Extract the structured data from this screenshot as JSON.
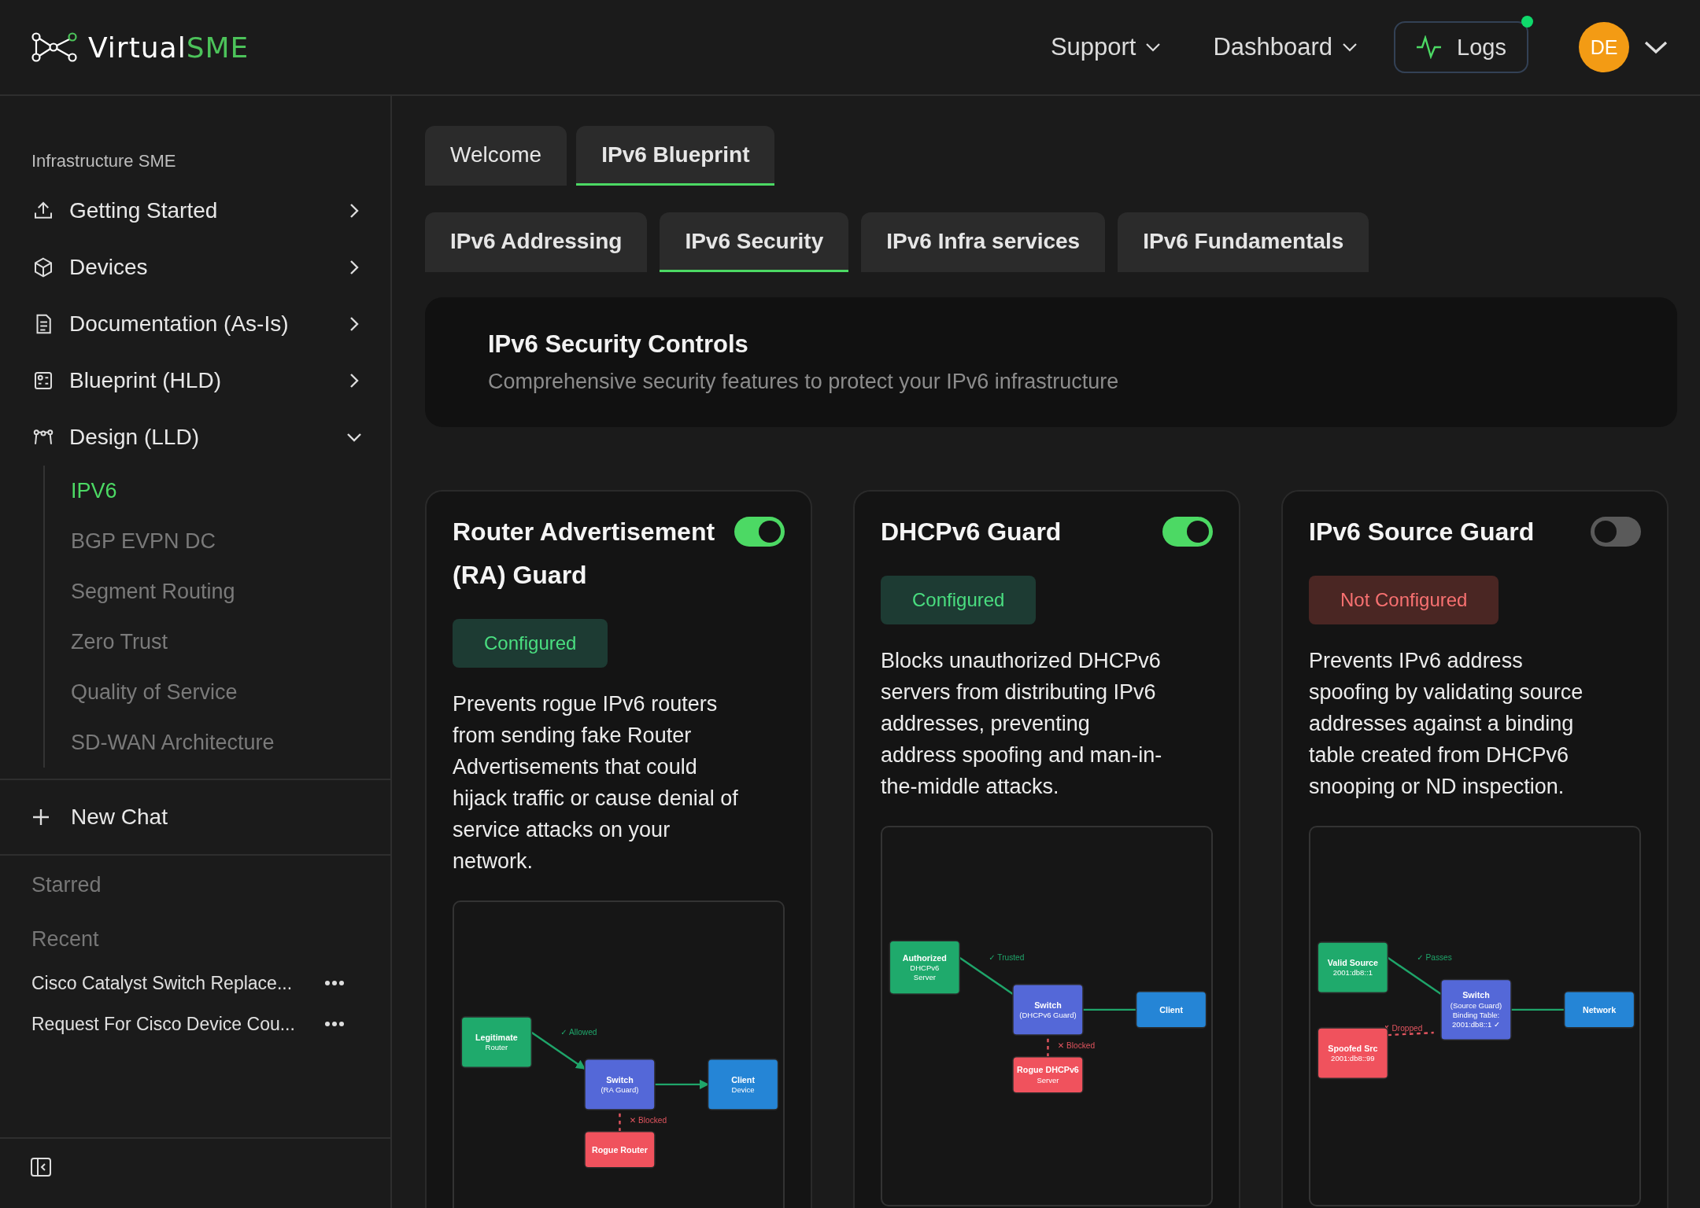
{
  "header": {
    "logo": {
      "part_1": "Virtual",
      "part_2": "SME"
    },
    "nav": [
      {
        "label": "Support"
      },
      {
        "label": "Dashboard"
      }
    ],
    "logs_button": {
      "label": "Logs",
      "notification": true
    },
    "avatar": {
      "initials": "DE"
    }
  },
  "sidebar": {
    "section_title": "Infrastructure SME",
    "items": [
      {
        "label": "Getting Started",
        "expanded": false
      },
      {
        "label": "Devices",
        "expanded": false
      },
      {
        "label": "Documentation (As-Is)",
        "expanded": false
      },
      {
        "label": "Blueprint (HLD)",
        "expanded": false
      },
      {
        "label": "Design (LLD)",
        "expanded": true,
        "children": [
          {
            "label": "IPV6",
            "selected": true
          },
          {
            "label": "BGP EVPN DC",
            "selected": false
          },
          {
            "label": "Segment Routing",
            "selected": false
          },
          {
            "label": "Zero Trust",
            "selected": false
          },
          {
            "label": "Quality of Service",
            "selected": false
          },
          {
            "label": "SD-WAN Architecture",
            "selected": false
          }
        ]
      }
    ],
    "new_chat": "New Chat",
    "starred_title": "Starred",
    "recent_title": "Recent",
    "recent": [
      {
        "label": "Cisco Catalyst Switch Replace..."
      },
      {
        "label": "Request For Cisco Device Cou..."
      }
    ]
  },
  "tabs": [
    {
      "label": "Welcome",
      "selected": false
    },
    {
      "label": "IPv6 Blueprint",
      "selected": true
    }
  ],
  "subtabs": [
    {
      "label": "IPv6 Addressing",
      "selected": false
    },
    {
      "label": "IPv6 Security",
      "selected": true
    },
    {
      "label": "IPv6 Infra services",
      "selected": false
    },
    {
      "label": "IPv6 Fundamentals",
      "selected": false
    }
  ],
  "section": {
    "title": "IPv6 Security Controls",
    "subtitle": "Comprehensive security features to protect your IPv6 infrastructure"
  },
  "cards": [
    {
      "title": "Router Advertisement (RA) Guard",
      "on": true,
      "status": {
        "label": "Configured",
        "kind": "configured"
      },
      "description": "Prevents rogue IPv6 routers from sending fake Router Advertisements that could hijack traffic or cause denial of service attacks on your network.",
      "diagram": {
        "arrows": true,
        "nodes": [
          {
            "kind": "source",
            "lines": [
              "Legitimate",
              "Router"
            ]
          },
          {
            "kind": "switch",
            "lines": [
              "Switch",
              "(RA Guard)"
            ]
          },
          {
            "kind": "target",
            "lines": [
              "Client",
              "Device"
            ]
          },
          {
            "kind": "rogue",
            "lines": [
              "Rogue Router"
            ]
          }
        ],
        "edges": [
          {
            "kind": "allowed",
            "label": "✓ Allowed"
          },
          {
            "kind": "link"
          },
          {
            "kind": "blocked",
            "label": "✕ Blocked"
          }
        ]
      }
    },
    {
      "title": "DHCPv6 Guard",
      "on": true,
      "status": {
        "label": "Configured",
        "kind": "configured"
      },
      "description": "Blocks unauthorized DHCPv6 servers from distributing IPv6 addresses, preventing address spoofing and man-in-the-middle attacks.",
      "diagram": {
        "arrows": false,
        "nodes": [
          {
            "kind": "source",
            "lines": [
              "Authorized",
              "DHCPv6",
              "Server"
            ]
          },
          {
            "kind": "switch",
            "lines": [
              "Switch",
              "(DHCPv6 Guard)"
            ]
          },
          {
            "kind": "target",
            "lines": [
              "Client"
            ]
          },
          {
            "kind": "rogue",
            "lines": [
              "Rogue DHCPv6",
              "Server"
            ]
          }
        ],
        "edges": [
          {
            "kind": "allowed",
            "label": "✓ Trusted"
          },
          {
            "kind": "link"
          },
          {
            "kind": "blocked",
            "label": "✕ Blocked"
          }
        ]
      }
    },
    {
      "title": "IPv6 Source Guard",
      "on": false,
      "status": {
        "label": "Not Configured",
        "kind": "not_configured"
      },
      "description": "Prevents IPv6 address spoofing by validating source addresses against a binding table created from DHCPv6 snooping or ND inspection.",
      "diagram": {
        "arrows": false,
        "nodes": [
          {
            "kind": "source",
            "lines": [
              "Valid Source",
              "2001:db8::1"
            ]
          },
          {
            "kind": "switch",
            "lines": [
              "Switch",
              "(Source Guard)",
              "Binding Table:",
              "2001:db8::1 ✓"
            ]
          },
          {
            "kind": "target",
            "lines": [
              "Network"
            ]
          },
          {
            "kind": "rogue-left",
            "lines": [
              "Spoofed Src",
              "2001:db8::99"
            ]
          }
        ],
        "edges": [
          {
            "kind": "allowed",
            "label": "✓ Passes"
          },
          {
            "kind": "link"
          },
          {
            "kind": "blocked",
            "label": "✗ Dropped"
          }
        ]
      }
    }
  ]
}
